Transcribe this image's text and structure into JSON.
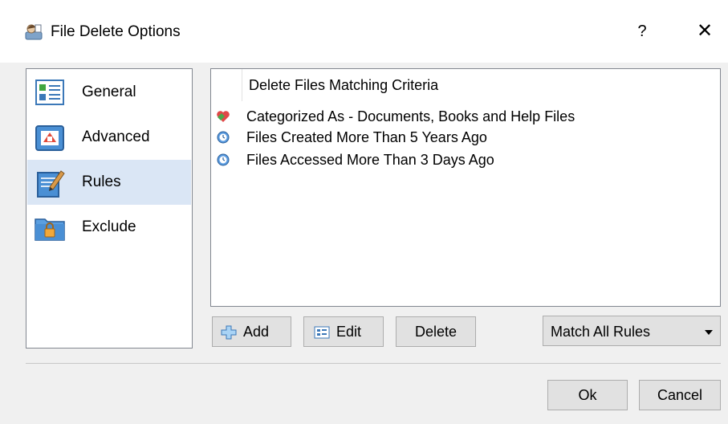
{
  "window": {
    "title": "File Delete Options",
    "help_label": "?",
    "close_label": "✕"
  },
  "nav": {
    "items": [
      {
        "label": "General",
        "icon": "general-settings-icon",
        "selected": false
      },
      {
        "label": "Advanced",
        "icon": "advanced-settings-icon",
        "selected": false
      },
      {
        "label": "Rules",
        "icon": "rules-icon",
        "selected": true
      },
      {
        "label": "Exclude",
        "icon": "exclude-folder-lock-icon",
        "selected": false
      }
    ]
  },
  "rules": {
    "header": "Delete Files Matching Criteria",
    "items": [
      {
        "text": "Categorized As - Documents, Books and Help Files",
        "icon": "category-icon"
      },
      {
        "text": "Files Created More Than 5 Years Ago",
        "icon": "clock-icon"
      },
      {
        "text": "Files Accessed More Than 3 Days Ago",
        "icon": "clock-icon"
      }
    ]
  },
  "toolbar": {
    "add_label": "Add",
    "edit_label": "Edit",
    "delete_label": "Delete",
    "match_value": "Match All Rules"
  },
  "footer": {
    "ok_label": "Ok",
    "cancel_label": "Cancel"
  },
  "colors": {
    "selected_bg": "#dae6f5",
    "button_bg": "#e1e1e1",
    "button_border": "#adadad"
  }
}
